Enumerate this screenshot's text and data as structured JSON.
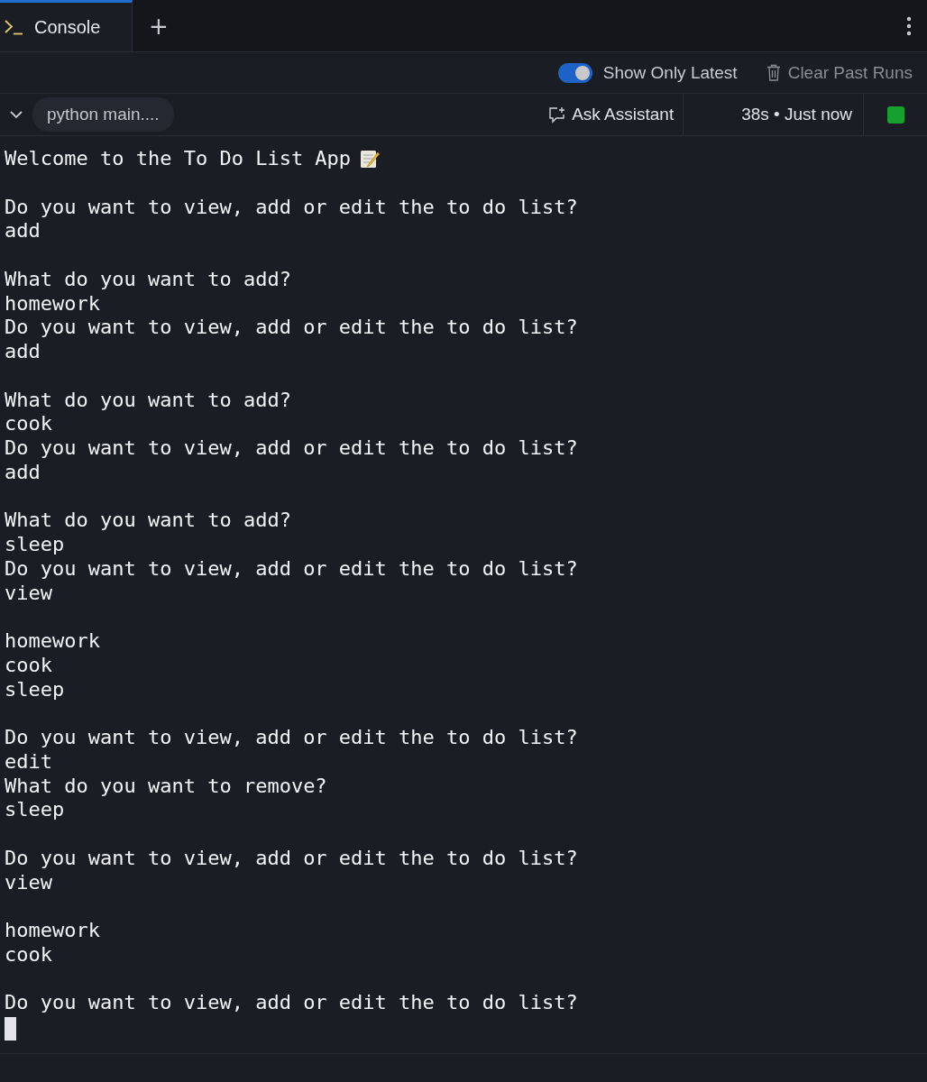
{
  "tabs": [
    {
      "label": "Console",
      "selected": true
    }
  ],
  "new_tab_button": "+",
  "toolbar": {
    "toggle": {
      "label": "Show Only Latest",
      "on": true
    },
    "clear_button": {
      "label": "Clear Past Runs",
      "disabled": true
    }
  },
  "run": {
    "expanded": true,
    "command": "python main....",
    "assistant_button": "Ask Assistant",
    "timing": "38s • Just now",
    "status_dot": {
      "color": "#16a12e"
    }
  },
  "output_blocks": [
    [
      "Welcome to the To Do List App"
    ],
    [
      "Do you want to view, add or edit the to do list?",
      "add"
    ],
    [
      "What do you want to add?",
      "homework",
      "Do you want to view, add or edit the to do list?",
      "add"
    ],
    [
      "What do you want to add?",
      "cook",
      "Do you want to view, add or edit the to do list?",
      "add"
    ],
    [
      "What do you want to add?",
      "sleep",
      "Do you want to view, add or edit the to do list?",
      "view"
    ],
    [
      "homework",
      "cook",
      "sleep"
    ],
    [
      "Do you want to view, add or edit the to do list?",
      "edit",
      "What do you want to remove?",
      "sleep"
    ],
    [
      "Do you want to view, add or edit the to do list?",
      "view"
    ],
    [
      "homework",
      "cook"
    ],
    [
      "Do you want to view, add or edit the to do list?"
    ]
  ]
}
